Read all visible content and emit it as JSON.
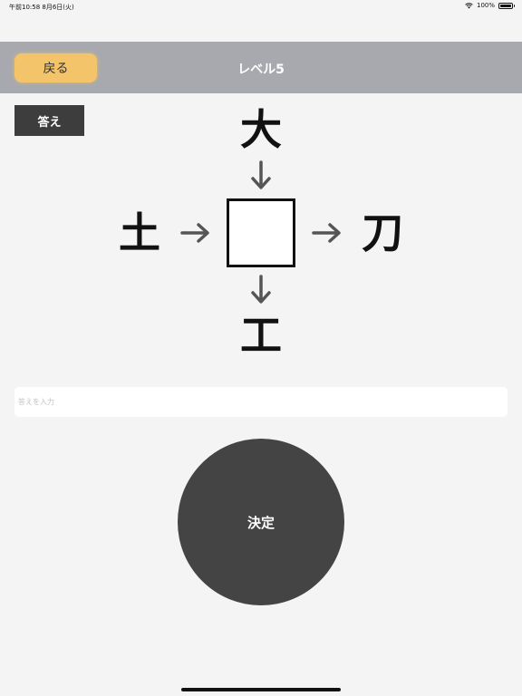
{
  "status_bar": {
    "time": "午前10:58  8月6日(火)",
    "battery_percent": "100%",
    "battery_level": 1.0
  },
  "nav": {
    "back_label": "戻る",
    "title": "レベル5"
  },
  "answer_button_label": "答え",
  "puzzle": {
    "top": "大",
    "left": "土",
    "right": "刀",
    "bottom": "工",
    "center": ""
  },
  "input": {
    "placeholder": "答えを入力",
    "value": ""
  },
  "submit_label": "決定",
  "colors": {
    "nav_bar": "#a7a9ae",
    "back_button": "#f3c46a",
    "dark_button": "#444444",
    "background": "#f4f4f4"
  },
  "icons": {
    "wifi": "wifi-icon",
    "battery": "battery-icon",
    "arrow_down": "arrow-down-icon",
    "arrow_right": "arrow-right-icon"
  }
}
